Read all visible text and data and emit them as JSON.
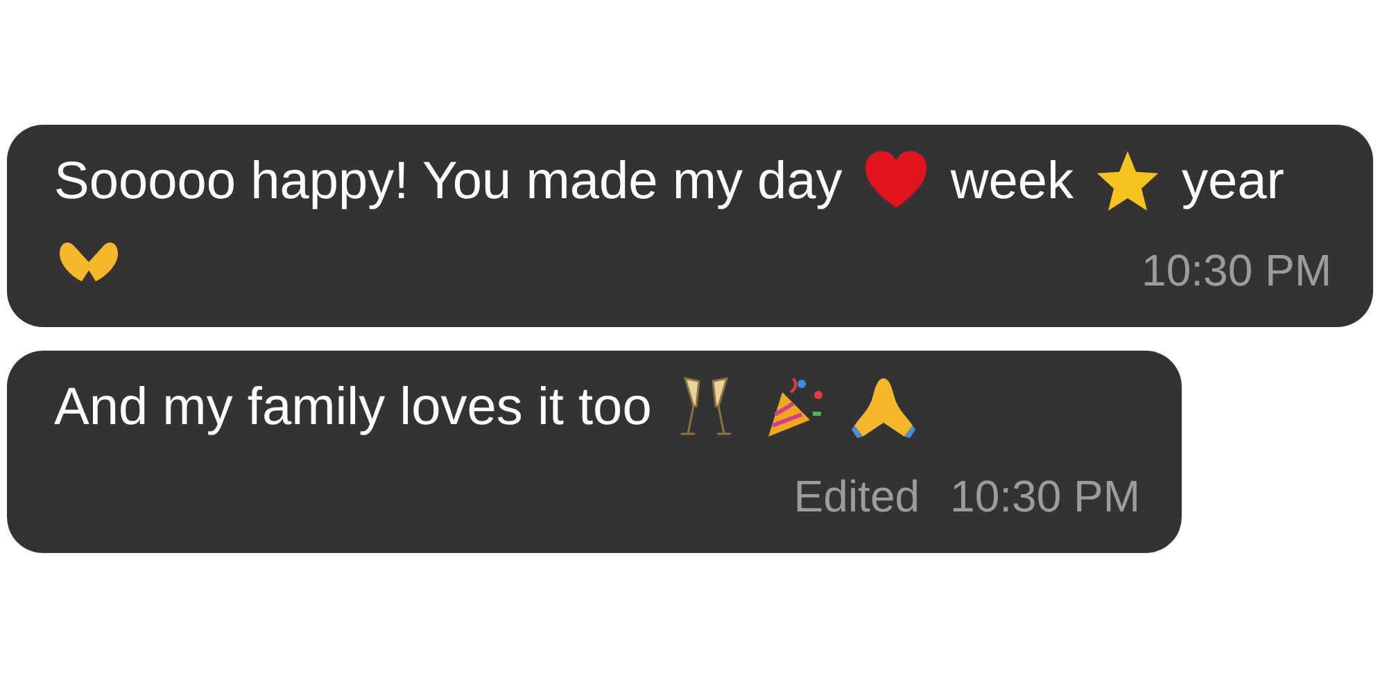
{
  "messages": [
    {
      "segments": [
        {
          "kind": "text",
          "text": "Sooooo happy! You made my day"
        },
        {
          "kind": "heart"
        },
        {
          "kind": "text",
          "text": "week"
        },
        {
          "kind": "star"
        },
        {
          "kind": "text",
          "text": "year"
        },
        {
          "kind": "heart-hands"
        }
      ],
      "time": "10:30 PM"
    },
    {
      "segments": [
        {
          "kind": "text",
          "text": "And my family loves it too"
        },
        {
          "kind": "glasses"
        },
        {
          "kind": "popper"
        },
        {
          "kind": "praying-hands"
        }
      ],
      "edited_label": "Edited",
      "time": "10:30 PM"
    }
  ]
}
